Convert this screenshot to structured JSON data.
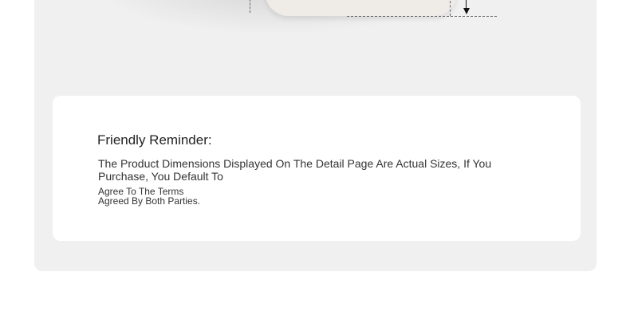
{
  "reminder": {
    "title": "Friendly Reminder:",
    "line1": "The Product Dimensions Displayed On The Detail Page Are Actual Sizes, If You Purchase, You Default To",
    "line2": "Agree To The Terms",
    "line3": "Agreed By Both Parties."
  },
  "colors": {
    "panel_background": "#f0f0f0",
    "card_background": "#ffffff",
    "cushion": "#efebe6",
    "text": "#333333"
  }
}
